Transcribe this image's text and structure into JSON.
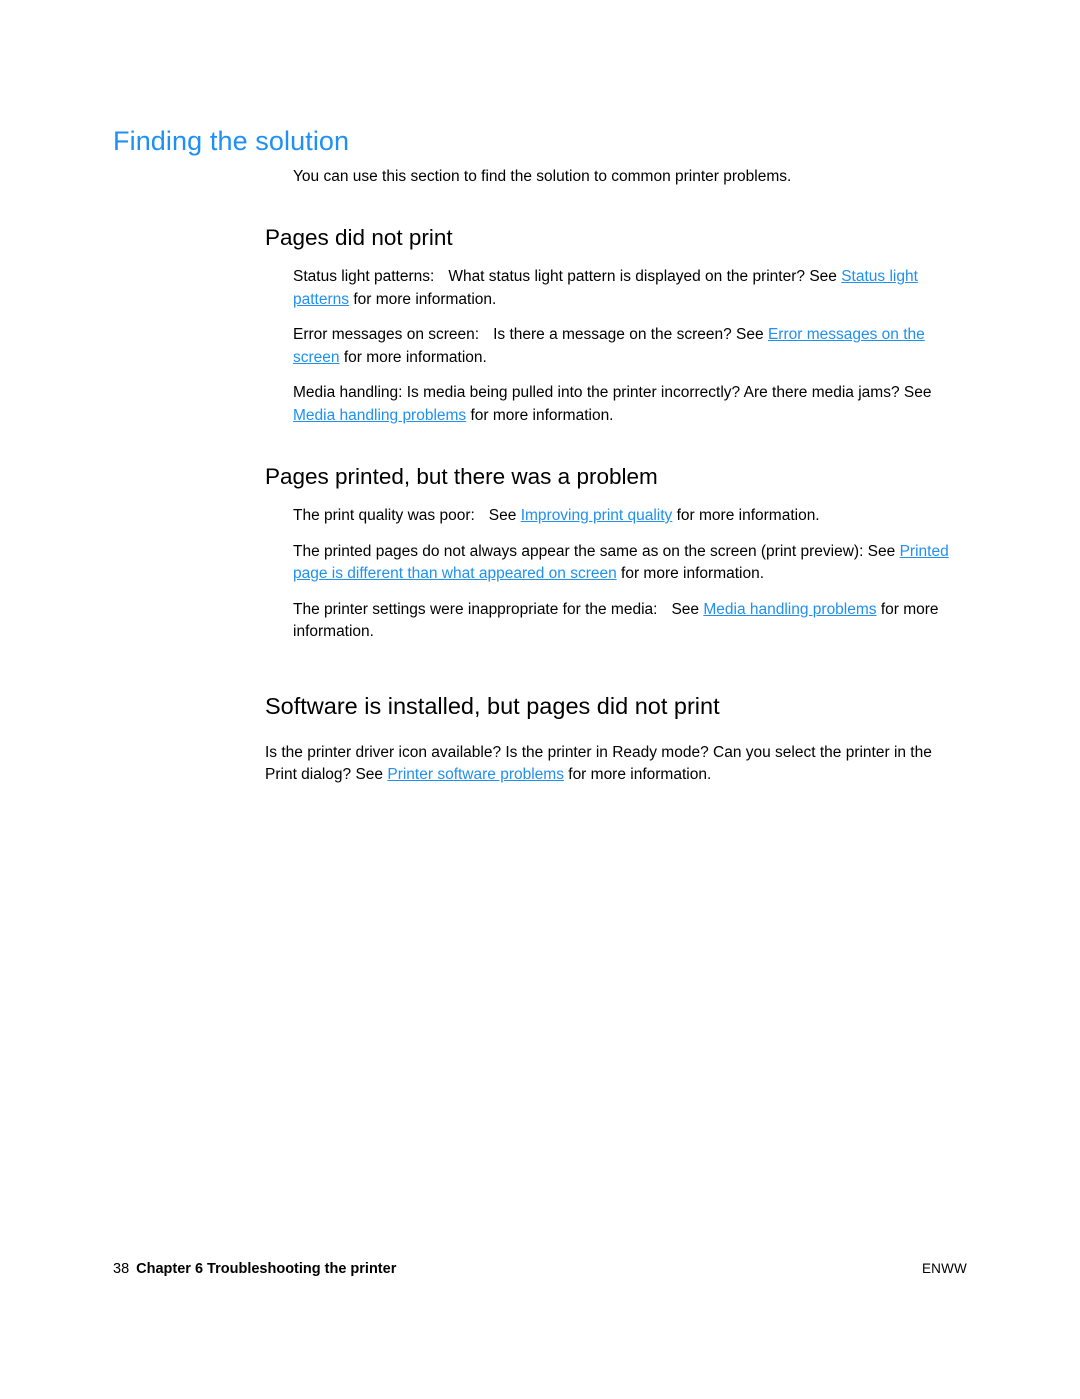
{
  "document": {
    "section_title": "Finding the solution",
    "intro": "You can use this section to find the solution to common printer problems.",
    "title_color": "#1e90f5",
    "link_color": "#2090f0"
  },
  "sections": [
    {
      "heading": "Pages did not print",
      "paragraphs": [
        {
          "parts": [
            {
              "type": "text",
              "value": "Status light patterns:"
            },
            {
              "type": "tab"
            },
            {
              "type": "text",
              "value": "What status light pattern is displayed on the printer? See "
            },
            {
              "type": "link",
              "value": "Status light patterns"
            },
            {
              "type": "text",
              "value": " for more information."
            }
          ]
        },
        {
          "parts": [
            {
              "type": "text",
              "value": "Error messages on screen:"
            },
            {
              "type": "tab"
            },
            {
              "type": "text",
              "value": "Is there a message on the screen? See "
            },
            {
              "type": "link",
              "value": "Error messages on the screen"
            },
            {
              "type": "text",
              "value": " for more information."
            }
          ]
        },
        {
          "parts": [
            {
              "type": "text",
              "value": "Media handling:  Is media being pulled into the printer incorrectly? Are there media jams? See "
            },
            {
              "type": "link",
              "value": "Media handling problems"
            },
            {
              "type": "text",
              "value": " for more information."
            }
          ]
        }
      ]
    },
    {
      "heading": "Pages printed, but there was a problem",
      "paragraphs": [
        {
          "parts": [
            {
              "type": "text",
              "value": "The print quality was poor:"
            },
            {
              "type": "tab"
            },
            {
              "type": "text",
              "value": "See "
            },
            {
              "type": "link",
              "value": "Improving print quality"
            },
            {
              "type": "text",
              "value": " for more information."
            }
          ]
        },
        {
          "parts": [
            {
              "type": "text",
              "value": "The printed pages do not always appear the same as on the screen (print preview): See "
            },
            {
              "type": "link",
              "value": "Printed page is different than what appeared on screen"
            },
            {
              "type": "text",
              "value": " for more information."
            }
          ]
        },
        {
          "parts": [
            {
              "type": "text",
              "value": "The printer settings were inappropriate for the media:"
            },
            {
              "type": "tab"
            },
            {
              "type": "text",
              "value": "See "
            },
            {
              "type": "link",
              "value": "Media handling problems"
            },
            {
              "type": "text",
              "value": " for more information."
            }
          ]
        }
      ]
    },
    {
      "heading": "Software is installed, but pages did not print",
      "flush": true,
      "paragraphs": [
        {
          "parts": [
            {
              "type": "text",
              "value": "Is the printer driver icon available? Is the printer in Ready mode? Can you select the printer in the Print  dialog? See "
            },
            {
              "type": "link",
              "value": "Printer software problems"
            },
            {
              "type": "text",
              "value": " for more information."
            }
          ]
        }
      ]
    }
  ],
  "footer": {
    "page_number": "38",
    "chapter_label": "Chapter 6 Troubleshooting the printer",
    "locale_code": "ENWW"
  }
}
